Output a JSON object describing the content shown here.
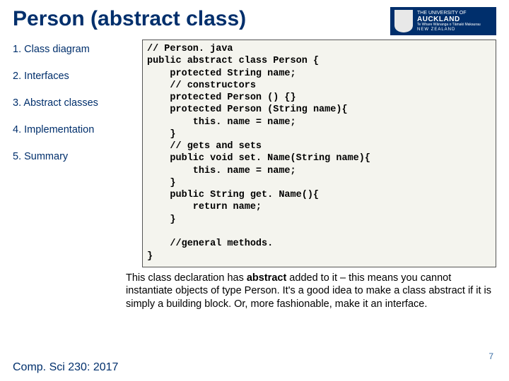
{
  "title": "Person (abstract class)",
  "logo": {
    "line1": "THE UNIVERSITY OF",
    "line2": "AUCKLAND",
    "line3": "Te Whare Wānanga o Tāmaki Makaurau",
    "line4": "NEW ZEALAND"
  },
  "sidebar": {
    "items": [
      "1. Class diagram",
      "2. Interfaces",
      "3. Abstract classes",
      "4. Implementation",
      "5. Summary"
    ]
  },
  "code": "// Person. java\npublic abstract class Person {\n    protected String name;\n    // constructors\n    protected Person () {}\n    protected Person (String name){\n        this. name = name;\n    }\n    // gets and sets\n    public void set. Name(String name){\n        this. name = name;\n    }\n    public String get. Name(){\n        return name;\n    }\n\n    //general methods.\n}",
  "description_pre": "This class declaration has ",
  "description_bold": "abstract",
  "description_post": " added to it – this means you cannot instantiate objects of type Person. It's a good idea to make a class abstract if it is simply a building block. Or, more fashionable, make it an interface.",
  "footer": "Comp. Sci 230: 2017",
  "page_number": "7"
}
